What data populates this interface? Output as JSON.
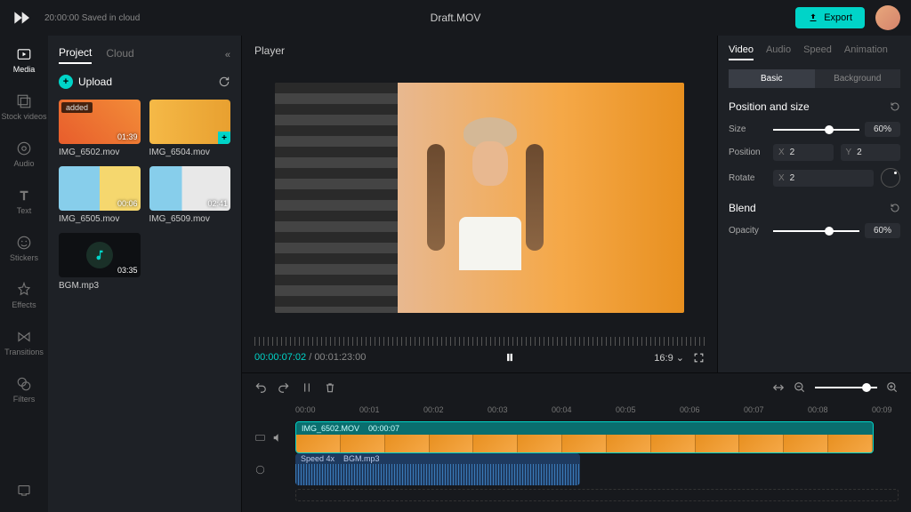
{
  "topbar": {
    "save_status": "20:00:00 Saved in cloud",
    "title": "Draft.MOV",
    "export_label": "Export"
  },
  "sidebar": {
    "items": [
      {
        "label": "Media"
      },
      {
        "label": "Stock videos"
      },
      {
        "label": "Audio"
      },
      {
        "label": "Text"
      },
      {
        "label": "Stickers"
      },
      {
        "label": "Effects"
      },
      {
        "label": "Transitions"
      },
      {
        "label": "Filters"
      }
    ]
  },
  "project_panel": {
    "tabs": {
      "project": "Project",
      "cloud": "Cloud"
    },
    "upload_label": "Upload",
    "media": [
      {
        "name": "IMG_6502.mov",
        "duration": "01:39",
        "badge": "added"
      },
      {
        "name": "IMG_6504.mov",
        "duration": ""
      },
      {
        "name": "IMG_6505.mov",
        "duration": "00:06"
      },
      {
        "name": "IMG_6509.mov",
        "duration": "02:41"
      },
      {
        "name": "BGM.mp3",
        "duration": "03:35"
      }
    ]
  },
  "player": {
    "header_label": "Player",
    "current_time": "00:00:07:02",
    "total_time": "00:01:23:00",
    "aspect_ratio": "16:9"
  },
  "inspector": {
    "tabs": {
      "video": "Video",
      "audio": "Audio",
      "speed": "Speed",
      "animation": "Animation"
    },
    "subtabs": {
      "basic": "Basic",
      "background": "Background"
    },
    "position_size": {
      "title": "Position and size",
      "size_label": "Size",
      "size_value": "60%",
      "size_pct": 60,
      "position_label": "Position",
      "pos_x": "2",
      "pos_y": "2",
      "rotate_label": "Rotate",
      "rotate_x": "2"
    },
    "blend": {
      "title": "Blend",
      "opacity_label": "Opacity",
      "opacity_value": "60%",
      "opacity_pct": 60
    }
  },
  "timeline": {
    "ruler_marks": [
      "00:00",
      "00:01",
      "00:02",
      "00:03",
      "00:04",
      "00:05",
      "00:06",
      "00:07",
      "00:08",
      "00:09"
    ],
    "video_clip": {
      "name": "IMG_6502.MOV",
      "time": "00:00:07"
    },
    "audio_clip": {
      "speed": "Speed 4x",
      "name": "BGM.mp3"
    }
  },
  "colors": {
    "accent": "#00d4c8"
  }
}
